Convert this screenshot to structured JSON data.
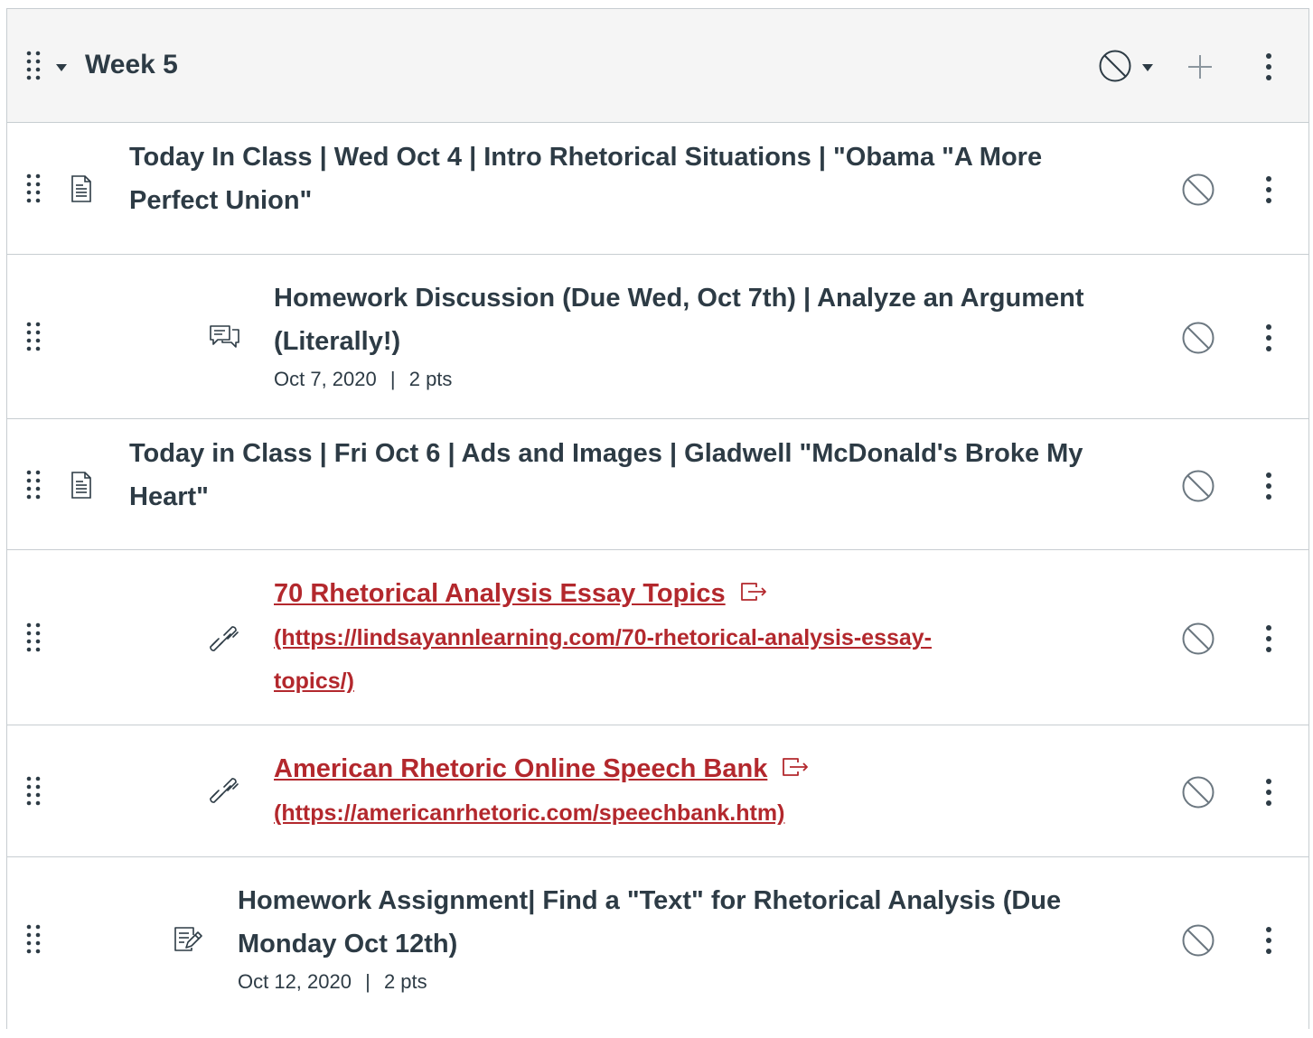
{
  "module": {
    "title": "Week 5"
  },
  "items": [
    {
      "type": "page",
      "title": "Today In Class | Wed Oct 4 | Intro Rhetorical Situations | \"Obama \"A More Perfect Union\""
    },
    {
      "type": "discussion",
      "title": "Homework Discussion (Due Wed, Oct 7th) | Analyze an Argument (Literally!)",
      "date": "Oct 7, 2020",
      "separator": "|",
      "points": "2 pts"
    },
    {
      "type": "page",
      "title": "Today in Class | Fri Oct 6 | Ads and Images | Gladwell \"McDonald's Broke My Heart\""
    },
    {
      "type": "external-link",
      "title": "70 Rhetorical Analysis Essay Topics",
      "url_line1": "(https://lindsayannlearning.com/70-rhetorical-analysis-essay-",
      "url_line2": "topics/)"
    },
    {
      "type": "external-link",
      "title": "American Rhetoric Online Speech Bank",
      "url_line1": "(https://americanrhetoric.com/speechbank.htm)"
    },
    {
      "type": "assignment",
      "title": "Homework Assignment| Find a \"Text\" for Rhetorical Analysis (Due Monday Oct 12th)",
      "date": "Oct 12, 2020",
      "separator": "|",
      "points": "2 pts"
    }
  ],
  "colors": {
    "text": "#2d3b45",
    "link": "#b3282d",
    "border": "#c7cdd1",
    "header_bg": "#f5f5f5",
    "icon": "#6b7780"
  }
}
